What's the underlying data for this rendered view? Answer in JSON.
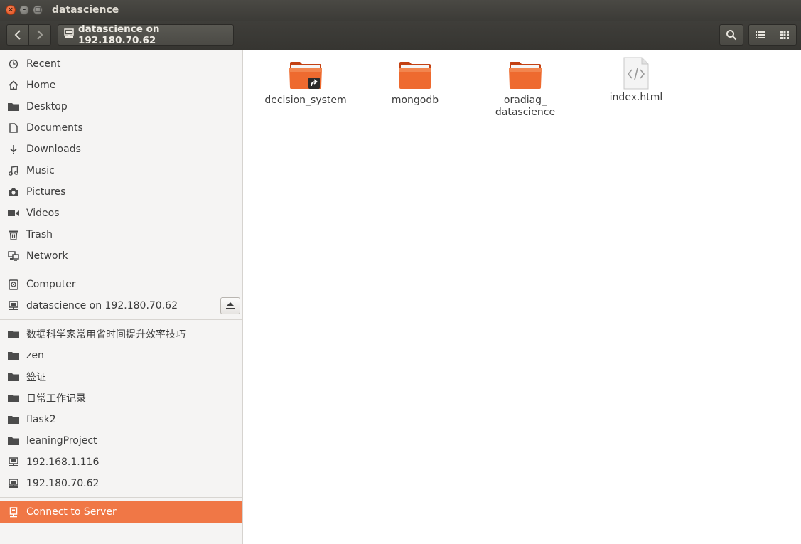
{
  "window": {
    "title": "datascience"
  },
  "toolbar": {
    "path_label": "datascience on 192.180.70.62",
    "icons": [
      "back-arrow-icon",
      "forward-arrow-icon",
      "network-drive-icon",
      "search-icon",
      "list-view-icon",
      "grid-view-icon"
    ]
  },
  "sidebar": {
    "places": [
      {
        "label": "Recent",
        "icon": "clock-icon"
      },
      {
        "label": "Home",
        "icon": "home-icon"
      },
      {
        "label": "Desktop",
        "icon": "folder-icon"
      },
      {
        "label": "Documents",
        "icon": "document-icon"
      },
      {
        "label": "Downloads",
        "icon": "download-icon"
      },
      {
        "label": "Music",
        "icon": "music-icon"
      },
      {
        "label": "Pictures",
        "icon": "camera-icon"
      },
      {
        "label": "Videos",
        "icon": "video-icon"
      },
      {
        "label": "Trash",
        "icon": "trash-icon"
      },
      {
        "label": "Network",
        "icon": "network-icon"
      }
    ],
    "devices": [
      {
        "label": "Computer",
        "icon": "computer-icon"
      },
      {
        "label": "datascience on 192.180.70.62",
        "icon": "network-drive-icon"
      }
    ],
    "bookmarks": [
      {
        "label": "数据科学家常用省时间提升效率技巧",
        "icon": "folder-icon"
      },
      {
        "label": "zen",
        "icon": "folder-icon"
      },
      {
        "label": "签证",
        "icon": "folder-icon"
      },
      {
        "label": "日常工作记录",
        "icon": "folder-icon"
      },
      {
        "label": "flask2",
        "icon": "folder-icon"
      },
      {
        "label": "leaningProject",
        "icon": "folder-icon"
      },
      {
        "label": "192.168.1.116",
        "icon": "network-drive-icon"
      },
      {
        "label": "192.180.70.62",
        "icon": "network-drive-icon"
      }
    ],
    "connect": {
      "label": "Connect to Server",
      "icon": "server-icon"
    }
  },
  "files": [
    {
      "name": "decision_system",
      "type": "folder-link"
    },
    {
      "name": "mongodb",
      "type": "folder"
    },
    {
      "name": "oradiag_ datascience",
      "line1": "oradiag_",
      "line2": "datascience",
      "type": "folder"
    },
    {
      "name": "index.html",
      "type": "html-file"
    }
  ],
  "colors": {
    "accent": "#f07746",
    "folder": "#e95420",
    "titlebar": "#3c3b37"
  }
}
